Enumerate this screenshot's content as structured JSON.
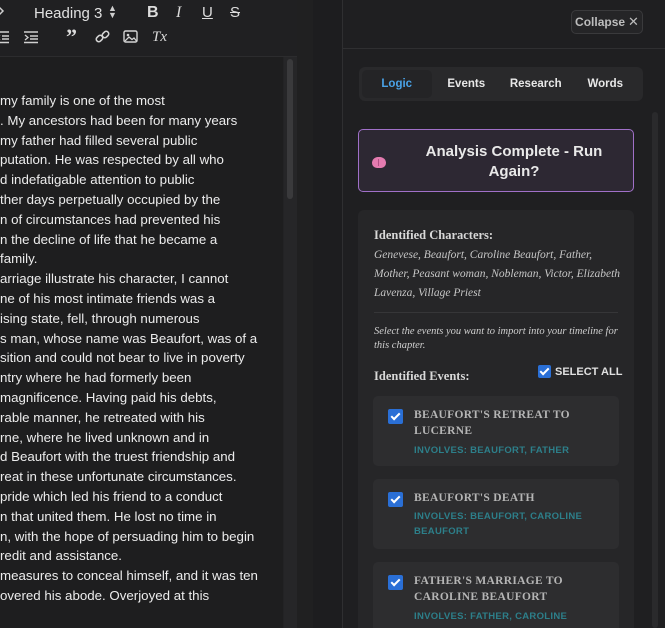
{
  "toolbar": {
    "heading_select": "Heading 3",
    "bold": "B",
    "italic": "I",
    "underline": "U",
    "strike": "S",
    "quote": "”",
    "clear_format": "Tx",
    "icons": [
      "outdent-icon",
      "indent-icon",
      "quote-icon",
      "link-icon",
      "image-icon",
      "clear-format-icon"
    ]
  },
  "document": {
    "lines": [
      "my family is one of the most",
      ". My ancestors had been for many years",
      "my father had filled several public",
      "putation. He was respected by all who",
      "d indefatigable attention to public",
      "ther days perpetually occupied by the",
      "n of circumstances had prevented his",
      "n the decline of life that he became a",
      "family.",
      "arriage illustrate his character, I cannot",
      "ne of his most intimate friends was a",
      "ising state, fell, through numerous",
      "s man, whose name was Beaufort, was of a",
      "sition and could not bear to live in poverty",
      "ntry where he had formerly been",
      "magnificence. Having paid his debts,",
      "rable manner, he retreated with his",
      "rne, where he lived unknown and in",
      "d Beaufort with the truest friendship and",
      "reat in these unfortunate circumstances.",
      "pride which led his friend to a conduct",
      "n that united them. He lost no time in",
      "n, with the hope of persuading him to begin",
      "redit and assistance.",
      "measures to conceal himself, and it was ten",
      "overed his abode. Overjoyed at this"
    ]
  },
  "panel": {
    "collapse_label": "Collapse",
    "collapse_icon": "✕",
    "tabs": [
      {
        "label": "Logic",
        "active": true
      },
      {
        "label": "Events",
        "active": false
      },
      {
        "label": "Research",
        "active": false
      },
      {
        "label": "Words",
        "active": false
      }
    ],
    "analysis_button": "Analysis Complete - Run Again?",
    "characters_title": "Identified Characters:",
    "characters": "Genevese, Beaufort, Caroline Beaufort, Father, Mother, Peasant woman, Nobleman, Victor, Elizabeth Lavenza, Village Priest",
    "hint": "Select the events you want to import into your timeline for this chapter.",
    "events_title": "Identified Events:",
    "select_all": "SELECT ALL",
    "events": [
      {
        "title": "Beaufort's retreat to Lucerne",
        "involves": "INVOLVES: BEAUFORT, FATHER",
        "checked": true
      },
      {
        "title": "Beaufort's death",
        "involves": "INVOLVES: BEAUFORT, CAROLINE BEAUFORT",
        "checked": true
      },
      {
        "title": "Father's marriage to Caroline Beaufort",
        "involves": "INVOLVES: FATHER, CAROLINE",
        "checked": true
      }
    ]
  },
  "colors": {
    "accent_tab": "#4aa3e8",
    "analysis_border": "#a070c8",
    "checkbox": "#2a6fd6",
    "involves_text": "#2d7f8a"
  }
}
